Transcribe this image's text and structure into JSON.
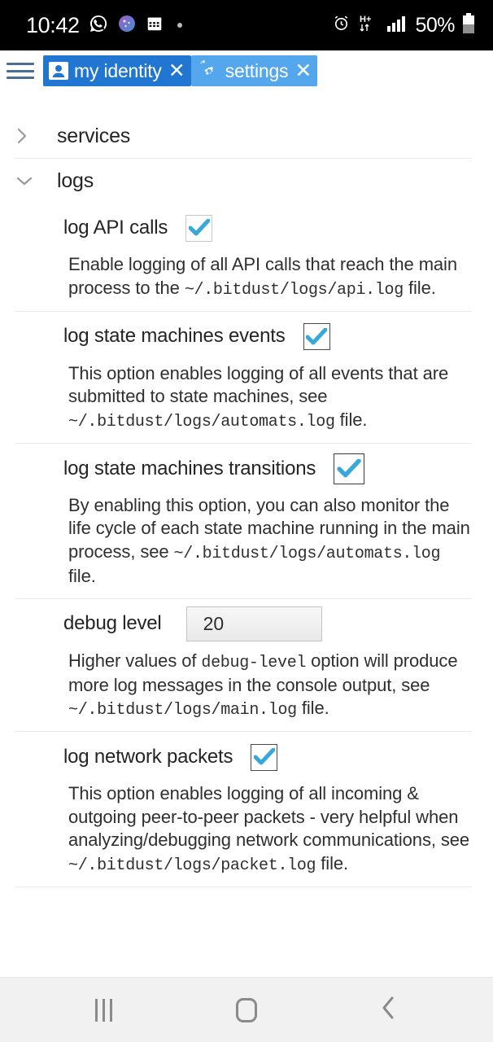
{
  "statusbar": {
    "clock": "10:42",
    "icons_left": [
      "whatsapp-icon",
      "app-circle-icon",
      "calendar-icon",
      "dot-icon"
    ],
    "icons_right": [
      "alarm-icon",
      "hplus-data-icon",
      "signal-icon"
    ],
    "hplus_label": "H+",
    "battery_text": "50%",
    "battery_icon": "battery-icon"
  },
  "tabbar": {
    "menu_icon": "hamburger-menu-icon",
    "tabs": [
      {
        "label": "my identity",
        "icon": "contact-card-icon",
        "close": "✕",
        "state": "active"
      },
      {
        "label": "settings",
        "icon": "gears-icon",
        "close": "✕",
        "state": "inactive"
      }
    ]
  },
  "main": {
    "groups": [
      {
        "label": "services",
        "expanded": false,
        "chevron": "chevron-right-icon"
      },
      {
        "label": "logs",
        "expanded": true,
        "chevron": "chevron-down-icon"
      }
    ],
    "options": [
      {
        "title": "log API calls",
        "control": "checkbox",
        "checked": true,
        "desc_parts": [
          {
            "text": "Enable logging of all API calls that reach the main process to the ",
            "mono": false
          },
          {
            "text": "~/.bitdust/logs/api.log",
            "mono": true
          },
          {
            "text": " file.",
            "mono": false
          }
        ]
      },
      {
        "title": "log state machines events",
        "control": "checkbox",
        "checked": true,
        "desc_parts": [
          {
            "text": "This option enables logging of all events that are submitted to state machines, see ",
            "mono": false
          },
          {
            "text": "~/.bitdust/logs/automats.log",
            "mono": true
          },
          {
            "text": " file.",
            "mono": false
          }
        ]
      },
      {
        "title": "log state machines transitions",
        "control": "checkbox",
        "checked": true,
        "desc_parts": [
          {
            "text": "By enabling this option, you can also monitor the life cycle of each state machine running in the main process, see ",
            "mono": false
          },
          {
            "text": "~/.bitdust/logs/automats.log",
            "mono": true
          },
          {
            "text": " file.",
            "mono": false
          }
        ]
      },
      {
        "title": "debug level",
        "control": "text",
        "value": "20",
        "desc_parts": [
          {
            "text": "Higher values of ",
            "mono": false
          },
          {
            "text": "debug-level",
            "mono": true
          },
          {
            "text": " option will produce more log messages in the console output, see ",
            "mono": false
          },
          {
            "text": "~/.bitdust/logs/main.log",
            "mono": true
          },
          {
            "text": " file.",
            "mono": false
          }
        ]
      },
      {
        "title": "log network packets",
        "control": "checkbox",
        "checked": true,
        "desc_parts": [
          {
            "text": "This option enables logging of all incoming & outgoing peer-to-peer packets - very helpful when analyzing/debugging network communications, see ",
            "mono": false
          },
          {
            "text": "~/.bitdust/logs/packet.log",
            "mono": true
          },
          {
            "text": " file.",
            "mono": false
          }
        ]
      }
    ]
  },
  "navbar": {
    "buttons": [
      {
        "name": "recent-apps-button",
        "icon": "recent-apps-icon"
      },
      {
        "name": "home-button",
        "icon": "home-icon"
      },
      {
        "name": "back-button",
        "icon": "back-chevron-icon"
      }
    ]
  },
  "colors": {
    "tab_active": "#2176d2",
    "tab_inactive": "#54a7ed",
    "check_blue": "#38a8db",
    "statusbar_bg": "#000000",
    "navbar_bg": "#f1f1f1"
  }
}
